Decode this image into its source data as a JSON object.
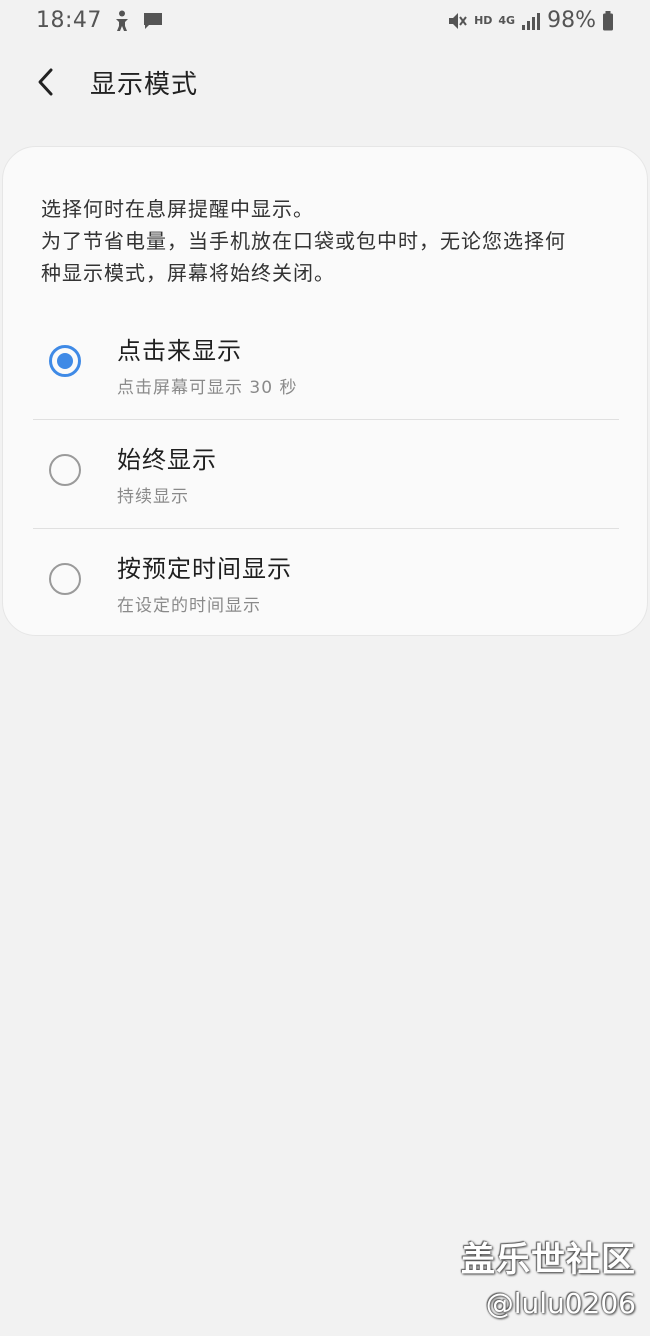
{
  "status_bar": {
    "time": "18:47",
    "network_hd": "HD",
    "network_4g": "4G",
    "battery": "98%",
    "icons": [
      "accessibility-icon",
      "message-icon",
      "mute-icon",
      "signal-icon",
      "battery-icon"
    ]
  },
  "header": {
    "title": "显示模式"
  },
  "card": {
    "description_lines": [
      "选择何时在息屏提醒中显示。",
      "为了节省电量，当手机放在口袋或包中时，无论您选择何",
      "种显示模式，屏幕将始终关闭。"
    ]
  },
  "options": [
    {
      "title": "点击来显示",
      "subtitle": "点击屏幕可显示 30 秒",
      "selected": true
    },
    {
      "title": "始终显示",
      "subtitle": "持续显示",
      "selected": false
    },
    {
      "title": "按预定时间显示",
      "subtitle": "在设定的时间显示",
      "selected": false
    }
  ],
  "watermark": {
    "line1": "盖乐世社区",
    "line2": "@lulu0206"
  },
  "colors": {
    "accent": "#3f8ae6",
    "background": "#f2f2f2",
    "card": "#fafafa"
  }
}
